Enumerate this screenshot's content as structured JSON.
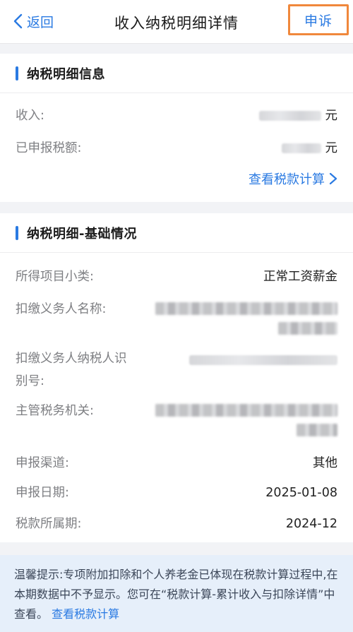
{
  "nav": {
    "back_label": "返回",
    "title": "收入纳税明细详情",
    "appeal_label": "申诉"
  },
  "section1": {
    "heading": "纳税明细信息",
    "income_label": "收入:",
    "income_unit": "元",
    "declared_tax_label": "已申报税额:",
    "declared_tax_unit": "元",
    "calc_link": "查看税款计算"
  },
  "section2": {
    "heading": "纳税明细-基础情况",
    "income_item_label": "所得项目小类:",
    "income_item_value": "正常工资薪金",
    "withholder_name_label": "扣缴义务人名称:",
    "withholder_id_label": "扣缴义务人纳税人识别号:",
    "tax_authority_label": "主管税务机关:",
    "channel_label": "申报渠道:",
    "channel_value": "其他",
    "date_label": "申报日期:",
    "date_value": "2025-01-08",
    "period_label": "税款所属期:",
    "period_value": "2024-12"
  },
  "tip": {
    "text": "温馨提示:专项附加扣除和个人养老金已体现在税款计算过程中,在本期数据中不予显示。您可在“税款计算-累计收入与扣除详情”中查看。",
    "link": "查看税款计算"
  },
  "colors": {
    "accent": "#2a7ae2",
    "highlight_border": "#f0883c",
    "tip_background": "#e6effa"
  }
}
